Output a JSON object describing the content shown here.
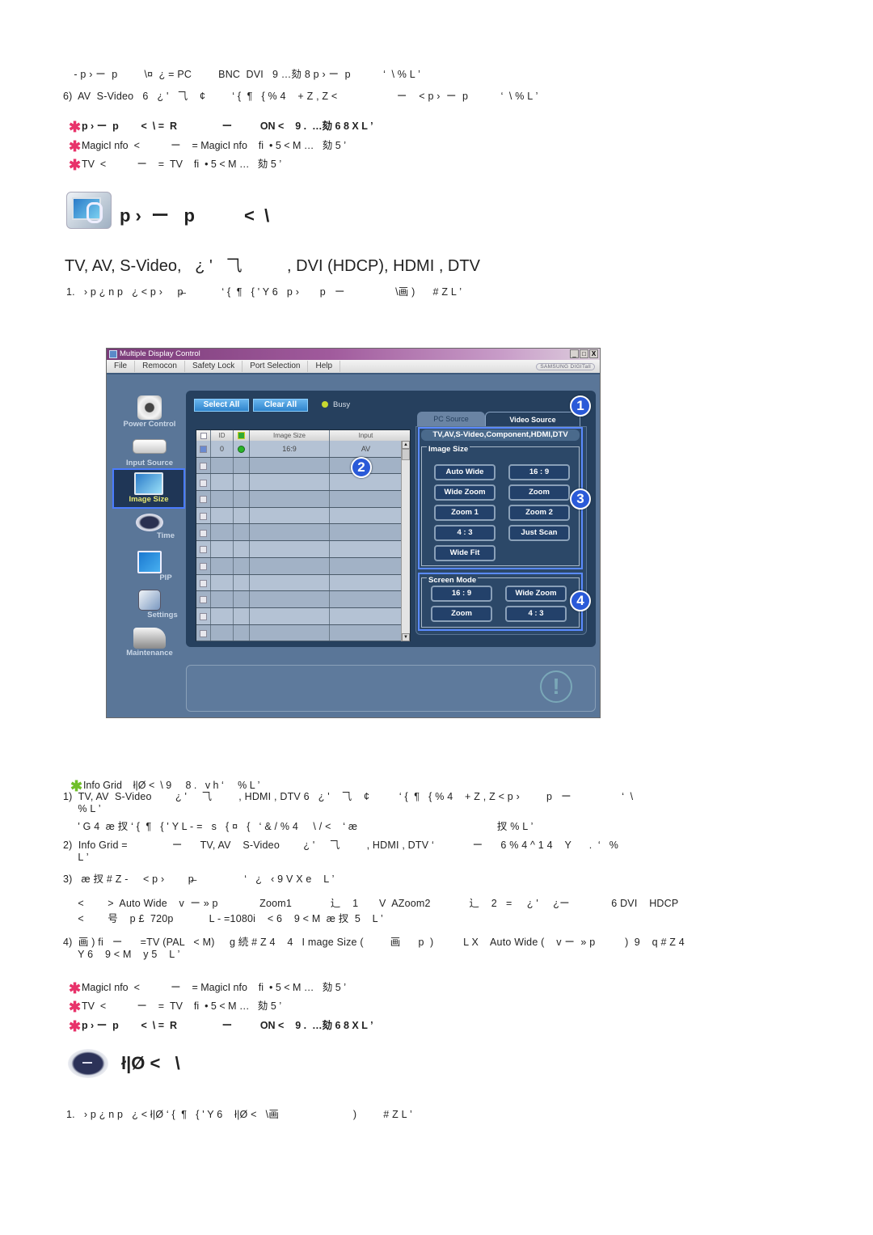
{
  "top_section": {
    "lines": [
      "  - p › ー  p         \\¤  ¿ = PC         BNC  DVI   9 …劾 8 p › ー  p           ‘  \\ % L ’",
      "6)  AV  S-Video   6   ¿ '   ⺄    ¢         ‘ {  ¶   { % 4    + Z , Z <                    ー    < p ›  ー  p           ‘  \\ % L ’"
    ],
    "notes": [
      {
        "text": "p › ー  p        <  \\ =  R                ー          ON <    9 .  …劾 6 8 X L ’",
        "bold": true
      },
      {
        "text": "MagicI nfo  <           ー    = MagicI nfo    fi  • 5 < M …   劾 5 ’",
        "bold": false
      },
      {
        "text": "TV  <           ー    =  TV    fi  • 5 < M …   劾 5 ’",
        "bold": false
      }
    ]
  },
  "section_image_size": {
    "title": "p ›  ー   p          <  \\",
    "subtitle": "TV, AV, S-Video,   ¿ '   ⺄          , DVI (HDCP), HDMI , DTV",
    "step1": "1.   › p ¿ n p   ¿ < p ›     p̶             ‘ {  ¶   { ' Y 6   p ›       p   ー                 \\画 )      # Z L ’"
  },
  "app": {
    "window_title": "Multiple Display Control",
    "window_buttons": [
      "_",
      "□",
      "X"
    ],
    "menu": [
      "File",
      "Remocon",
      "Safety Lock",
      "Port Selection",
      "Help"
    ],
    "brand": "SAMSUNG DIGITall",
    "sidebar": [
      {
        "label": "Power Control",
        "icon": "power-control-icon",
        "active": false
      },
      {
        "label": "Input Source",
        "icon": "input-source-icon",
        "active": false
      },
      {
        "label": "Image Size",
        "icon": "image-size-icon",
        "active": true
      },
      {
        "label": "Time",
        "icon": "time-icon",
        "active": false
      },
      {
        "label": "PIP",
        "icon": "pip-icon",
        "active": false
      },
      {
        "label": "Settings",
        "icon": "settings-icon",
        "active": false
      },
      {
        "label": "Maintenance",
        "icon": "maintenance-icon",
        "active": false
      }
    ],
    "select_all": "Select All",
    "clear_all": "Clear All",
    "busy_label": "Busy",
    "grid": {
      "columns": [
        "",
        "ID",
        "",
        "Image Size",
        "Input"
      ],
      "rows": [
        {
          "checked": true,
          "id": "0",
          "status": "on",
          "image_size": "16:9",
          "input": "AV"
        },
        {
          "checked": false,
          "id": "",
          "status": "",
          "image_size": "",
          "input": ""
        },
        {
          "checked": false,
          "id": "",
          "status": "",
          "image_size": "",
          "input": ""
        },
        {
          "checked": false,
          "id": "",
          "status": "",
          "image_size": "",
          "input": ""
        },
        {
          "checked": false,
          "id": "",
          "status": "",
          "image_size": "",
          "input": ""
        },
        {
          "checked": false,
          "id": "",
          "status": "",
          "image_size": "",
          "input": ""
        },
        {
          "checked": false,
          "id": "",
          "status": "",
          "image_size": "",
          "input": ""
        },
        {
          "checked": false,
          "id": "",
          "status": "",
          "image_size": "",
          "input": ""
        },
        {
          "checked": false,
          "id": "",
          "status": "",
          "image_size": "",
          "input": ""
        },
        {
          "checked": false,
          "id": "",
          "status": "",
          "image_size": "",
          "input": ""
        },
        {
          "checked": false,
          "id": "",
          "status": "",
          "image_size": "",
          "input": ""
        },
        {
          "checked": false,
          "id": "",
          "status": "",
          "image_size": "",
          "input": ""
        }
      ]
    },
    "tabs": [
      "PC Source",
      "Video Source"
    ],
    "active_tab": "Video Source",
    "sources_header": "TV,AV,S-Video,Component,HDMI,DTV",
    "image_size_group": {
      "legend": "Image Size",
      "buttons": [
        "Auto Wide",
        "16 : 9",
        "Wide Zoom",
        "Zoom",
        "Zoom 1",
        "Zoom 2",
        "4 : 3",
        "Just Scan",
        "Wide Fit"
      ]
    },
    "screen_mode_group": {
      "legend": "Screen Mode",
      "buttons": [
        "16 : 9",
        "Wide Zoom",
        "Zoom",
        "4 : 3"
      ]
    },
    "callouts": [
      "1",
      "2",
      "3",
      "4"
    ],
    "warning_symbol": "!"
  },
  "notes_section": {
    "info_note": "Info Grid    ł|Ø <  \\ 9     8 .   v h ‘     % L ’",
    "items": [
      "1)  TV, AV  S-Video        ¿ '     ⺄         , HDMI , DTV 6   ¿ '    ⺄    ¢          ‘ {  ¶   { % 4    + Z , Z < p ›         p   ー                 ‘  \\",
      "     % L ’",
      "     ' G 4  æ 扠 ‘ {  ¶   { ' Y L - =   s   { ¤   {   ‘ & / % 4     \\ / <    ‘ æ                                               扠 % L ’",
      "2)  Info Grid =               ー      TV, AV    S-Video        ¿ '     ⺄         , HDMI , DTV ‘             ー      6 % 4 ^ 1 4    Y      .  ‘   %",
      "     L ’",
      "3)   æ 扠 # Z -     < p ›        p̶                 ‘   ¿   ‹ 9 V X e    L ’",
      "     <        >  Auto Wide    v  ー » p              Zoom1             ⻌    1       V  AZoom2             ⻌    2   =     ¿ '     ¿ー              6 DVI    HDCP",
      "     <        号    p £  720p            L - =1080i    < 6    9 < M  æ 扠  5    L ’",
      "4)  画 ) fi   ー      =TV (PAL   < M)     g 続 # Z 4    4   I mage Size (         画      p  )          L X    Auto Wide (    v ー  » p          )  9    q # Z 4",
      "     Y 6    9 < M    y 5    L ’"
    ],
    "notes": [
      {
        "text": "MagicI nfo  <           ー    = MagicI nfo    fi  • 5 < M …   劾 5 ’",
        "bold": false
      },
      {
        "text": "TV  <           ー    =  TV    fi  • 5 < M …   劾 5 ’",
        "bold": false
      },
      {
        "text": "p › ー  p        <  \\ =  R                ー          ON <    9 .  …劾 6 8 X L ’",
        "bold": true
      }
    ]
  },
  "section_time": {
    "title": "ł|Ø <   \\",
    "step1": "1.   › p ¿ n p   ¿ < ł|Ø ‘ {  ¶   { ' Y 6    ł|Ø <   \\画                         )         # Z L ’"
  }
}
